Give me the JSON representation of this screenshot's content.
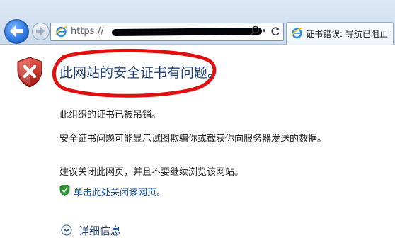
{
  "browser": {
    "address_bar": {
      "url_prefix": "https://",
      "url_redacted": true
    },
    "tab": {
      "title": "证书错误: 导航已阻止"
    }
  },
  "page": {
    "headline": "此网站的安全证书有问题。",
    "paragraphs": [
      "此组织的证书已被吊销。",
      "安全证书问题可能显示试图欺骗你或截获你向服务器发送的数据。",
      "建议关闭此网页，并且不要继续浏览该网站。"
    ],
    "close_link": "单击此处关闭该网页。",
    "details_toggle": "详细信息"
  },
  "colors": {
    "headline": "#1f3f7a",
    "link": "#1a56a8",
    "annotation_circle": "#e01010",
    "error_shield": "#c0241c"
  },
  "icons": {
    "back": "back-arrow-icon",
    "forward": "forward-arrow-icon",
    "site": "ie-logo-icon",
    "search": "search-icon",
    "refresh": "refresh-icon",
    "error": "error-shield-icon",
    "safe": "green-shield-check-icon",
    "expand": "chevron-down-circle-icon"
  }
}
